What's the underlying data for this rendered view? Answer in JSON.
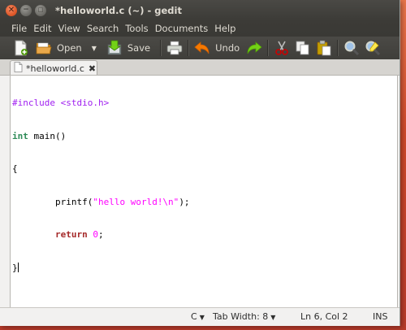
{
  "window": {
    "title": "*helloworld.c (~) - gedit"
  },
  "menu": {
    "items": [
      "File",
      "Edit",
      "View",
      "Search",
      "Tools",
      "Documents",
      "Help"
    ]
  },
  "toolbar": {
    "open_label": "Open",
    "save_label": "Save",
    "undo_label": "Undo"
  },
  "tab": {
    "label": "*helloworld.c"
  },
  "editor": {
    "lines": [
      "#include <stdio.h>",
      "int main()",
      "{",
      "        printf(\"hello world!\\n\");",
      "        return 0;",
      "}"
    ]
  },
  "status": {
    "language": "C",
    "tab_width": "Tab Width: 8",
    "position": "Ln 6, Col 2",
    "mode": "INS"
  },
  "colors": {
    "preprocessor": "#a020f0",
    "type": "#2e8b57",
    "keyword": "#a52a2a",
    "string": "#ff00ff"
  }
}
